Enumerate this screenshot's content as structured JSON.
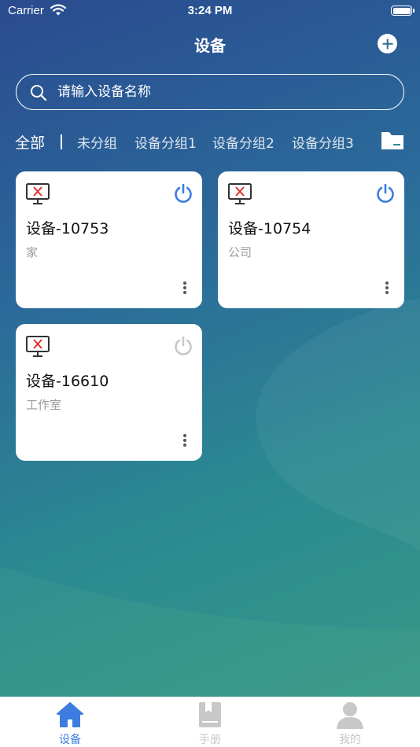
{
  "status_bar": {
    "carrier": "Carrier",
    "time": "3:24 PM"
  },
  "header": {
    "title": "设备",
    "add_icon": "plus-circle-icon"
  },
  "search": {
    "placeholder": "请输入设备名称",
    "value": ""
  },
  "tabs": {
    "items": [
      {
        "label": "全部",
        "active": true
      },
      {
        "label": "未分组",
        "active": false
      },
      {
        "label": "设备分组1",
        "active": false
      },
      {
        "label": "设备分组2",
        "active": false
      },
      {
        "label": "设备分组3",
        "active": false
      }
    ],
    "manage_icon": "folder-icon"
  },
  "devices": [
    {
      "name": "设备-10753",
      "group": "家",
      "status_icon": "monitor-offline-icon",
      "power": "on"
    },
    {
      "name": "设备-10754",
      "group": "公司",
      "status_icon": "monitor-offline-icon",
      "power": "on"
    },
    {
      "name": "设备-16610",
      "group": "工作室",
      "status_icon": "monitor-offline-icon",
      "power": "off"
    }
  ],
  "tabbar": {
    "items": [
      {
        "label": "设备",
        "icon": "home-icon",
        "active": true
      },
      {
        "label": "手册",
        "icon": "book-icon",
        "active": false
      },
      {
        "label": "我的",
        "icon": "person-icon",
        "active": false
      }
    ]
  },
  "colors": {
    "accent": "#3d7de0",
    "power_on": "#3d7de0",
    "power_off": "#c8c8c8",
    "monitor_x": "#e03030",
    "tab_inactive": "#c8c8c8"
  }
}
